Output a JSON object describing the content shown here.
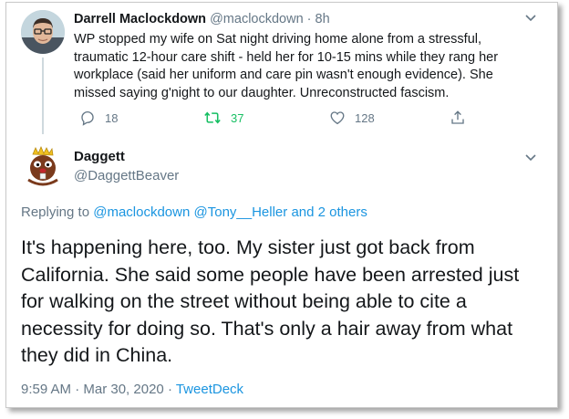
{
  "reply_tweet": {
    "author_name": "Darrell Maclockdown",
    "handle": "@maclockdown",
    "separator": "·",
    "time_ago": "8h",
    "text": "WP stopped my wife on Sat night driving home alone from a stressful, traumatic 12-hour care shift - held her for 10-15 mins while they rang her workplace (said her uniform and care pin wasn't enough evidence). She missed saying g'night to our daughter. Unreconstructed fascism.",
    "replies": "18",
    "retweets": "37",
    "likes": "128"
  },
  "main_tweet": {
    "author_name": "Daggett",
    "handle": "@DaggettBeaver",
    "replying_prefix": "Replying to",
    "mention_1": "@maclockdown",
    "mention_2": "@Tony__Heller",
    "and_others": "and 2 others",
    "text": "It's happening here, too.  My sister just got back from California. She said some people have been arrested just for walking on the street without being able to cite a necessity for doing so.  That's only a hair away from what they did in China.",
    "timestamp": "9:59 AM · Mar 30, 2020",
    "meta_separator": "·",
    "source": "TweetDeck"
  },
  "icons": {
    "caret": "chevron-down-icon",
    "reply": "reply-icon",
    "retweet": "retweet-icon",
    "like": "heart-icon",
    "share": "share-icon"
  },
  "colors": {
    "link": "#1b95e0",
    "retweeted": "#17bf63",
    "muted": "#657786",
    "text": "#14171a"
  }
}
